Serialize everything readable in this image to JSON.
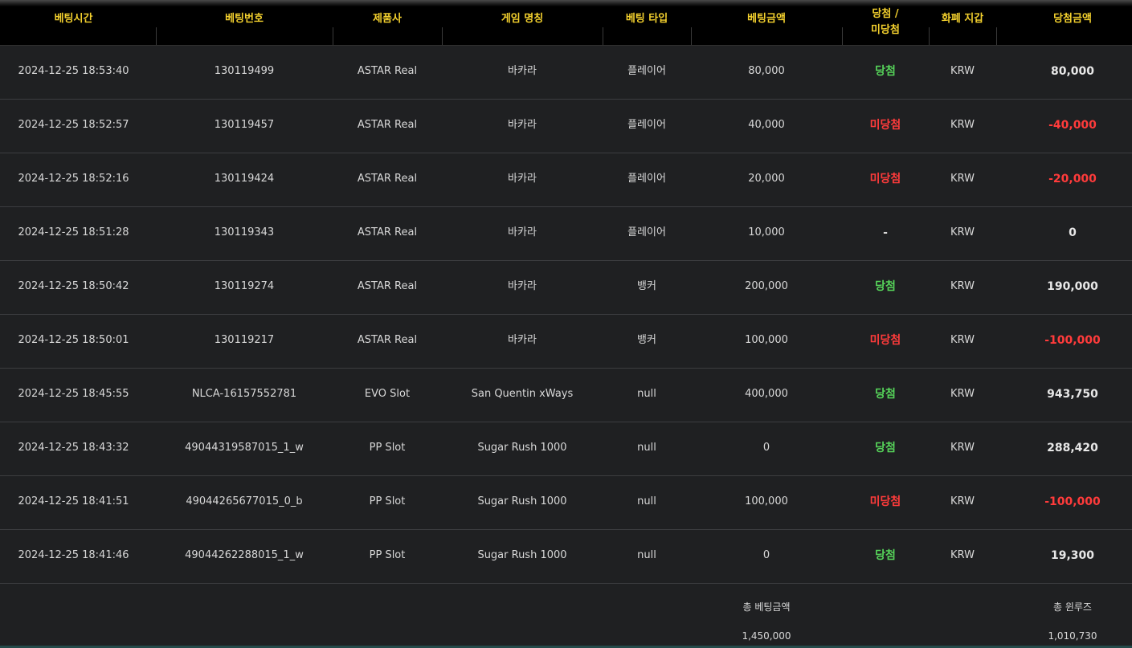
{
  "headers": {
    "bet_time": "베팅시간",
    "bet_number": "베팅번호",
    "provider": "제품사",
    "game_name": "게임 명칭",
    "bet_type": "베팅 타입",
    "bet_amount": "베팅금액",
    "result_line1": "당첨 /",
    "result_line2": "미당첨",
    "currency": "화폐 지갑",
    "win_amount": "당첨금액"
  },
  "rows": [
    {
      "time": "2024-12-25 18:53:40",
      "number": "130119499",
      "provider": "ASTAR Real",
      "game": "바카라",
      "type": "플레이어",
      "bet": "80,000",
      "result": "당첨",
      "result_status": "win",
      "currency": "KRW",
      "win_amount": "80,000",
      "amount_negative": false
    },
    {
      "time": "2024-12-25 18:52:57",
      "number": "130119457",
      "provider": "ASTAR Real",
      "game": "바카라",
      "type": "플레이어",
      "bet": "40,000",
      "result": "미당첨",
      "result_status": "lose",
      "currency": "KRW",
      "win_amount": "-40,000",
      "amount_negative": true
    },
    {
      "time": "2024-12-25 18:52:16",
      "number": "130119424",
      "provider": "ASTAR Real",
      "game": "바카라",
      "type": "플레이어",
      "bet": "20,000",
      "result": "미당첨",
      "result_status": "lose",
      "currency": "KRW",
      "win_amount": "-20,000",
      "amount_negative": true
    },
    {
      "time": "2024-12-25 18:51:28",
      "number": "130119343",
      "provider": "ASTAR Real",
      "game": "바카라",
      "type": "플레이어",
      "bet": "10,000",
      "result": "-",
      "result_status": "none",
      "currency": "KRW",
      "win_amount": "0",
      "amount_negative": false
    },
    {
      "time": "2024-12-25 18:50:42",
      "number": "130119274",
      "provider": "ASTAR Real",
      "game": "바카라",
      "type": "뱅커",
      "bet": "200,000",
      "result": "당첨",
      "result_status": "win",
      "currency": "KRW",
      "win_amount": "190,000",
      "amount_negative": false
    },
    {
      "time": "2024-12-25 18:50:01",
      "number": "130119217",
      "provider": "ASTAR Real",
      "game": "바카라",
      "type": "뱅커",
      "bet": "100,000",
      "result": "미당첨",
      "result_status": "lose",
      "currency": "KRW",
      "win_amount": "-100,000",
      "amount_negative": true
    },
    {
      "time": "2024-12-25 18:45:55",
      "number": "NLCA-16157552781",
      "provider": "EVO Slot",
      "game": "San Quentin xWays",
      "type": "null",
      "bet": "400,000",
      "result": "당첨",
      "result_status": "win",
      "currency": "KRW",
      "win_amount": "943,750",
      "amount_negative": false
    },
    {
      "time": "2024-12-25 18:43:32",
      "number": "49044319587015_1_w",
      "provider": "PP Slot",
      "game": "Sugar Rush 1000",
      "type": "null",
      "bet": "0",
      "result": "당첨",
      "result_status": "win",
      "currency": "KRW",
      "win_amount": "288,420",
      "amount_negative": false
    },
    {
      "time": "2024-12-25 18:41:51",
      "number": "49044265677015_0_b",
      "provider": "PP Slot",
      "game": "Sugar Rush 1000",
      "type": "null",
      "bet": "100,000",
      "result": "미당첨",
      "result_status": "lose",
      "currency": "KRW",
      "win_amount": "-100,000",
      "amount_negative": true
    },
    {
      "time": "2024-12-25 18:41:46",
      "number": "49044262288015_1_w",
      "provider": "PP Slot",
      "game": "Sugar Rush 1000",
      "type": "null",
      "bet": "0",
      "result": "당첨",
      "result_status": "win",
      "currency": "KRW",
      "win_amount": "19,300",
      "amount_negative": false
    }
  ],
  "footer": {
    "total_bet_label": "총 베팅금액",
    "total_bet_value": "1,450,000",
    "total_winloss_label": "총 윈루즈",
    "total_winloss_value": "1,010,730"
  },
  "colors": {
    "header_text": "#f4d12e",
    "win": "#56d45a",
    "lose": "#ff3b3b",
    "background": "#1f2022"
  }
}
